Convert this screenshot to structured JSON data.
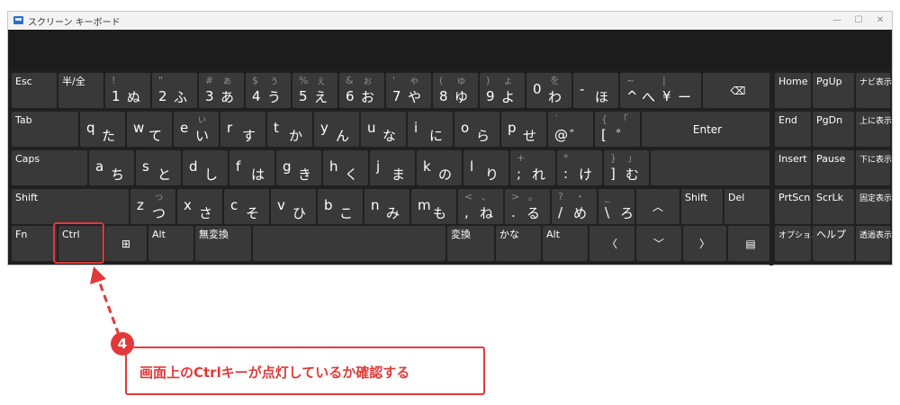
{
  "window": {
    "title": "スクリーン キーボード",
    "minimize_glyph": "—",
    "maximize_glyph": "☐",
    "close_glyph": "✕"
  },
  "keys": {
    "esc": "Esc",
    "hankaku": "半/全",
    "k1": {
      "main": "1",
      "kana": "ぬ",
      "shift": "!"
    },
    "k2": {
      "main": "2",
      "kana": "ふ",
      "shift": "\""
    },
    "k3": {
      "main": "3",
      "kana": "あ",
      "shift": "#",
      "skana": "ぁ"
    },
    "k4": {
      "main": "4",
      "kana": "う",
      "shift": "$",
      "skana": "ぅ"
    },
    "k5": {
      "main": "5",
      "kana": "え",
      "shift": "%",
      "skana": "ぇ"
    },
    "k6": {
      "main": "6",
      "kana": "お",
      "shift": "&",
      "skana": "ぉ"
    },
    "k7": {
      "main": "7",
      "kana": "や",
      "shift": "'",
      "skana": "ゃ"
    },
    "k8": {
      "main": "8",
      "kana": "ゆ",
      "shift": "(",
      "skana": "ゅ"
    },
    "k9": {
      "main": "9",
      "kana": "よ",
      "shift": ")",
      "skana": "ょ"
    },
    "k0": {
      "main": "0",
      "kana": "わ",
      "skana": "を"
    },
    "minus": {
      "main": "-",
      "kana": "ほ"
    },
    "caret": {
      "main": "^",
      "kana": "へ",
      "shift": "~"
    },
    "yen": {
      "main": "¥",
      "kana": "ー",
      "shift": "|"
    },
    "backspace_glyph": "⌫",
    "tab": "Tab",
    "q": {
      "main": "q",
      "kana": "た"
    },
    "w": {
      "main": "w",
      "kana": "て"
    },
    "e": {
      "main": "e",
      "kana": "い",
      "skana": "ぃ"
    },
    "r": {
      "main": "r",
      "kana": "す"
    },
    "t": {
      "main": "t",
      "kana": "か"
    },
    "y": {
      "main": "y",
      "kana": "ん"
    },
    "u": {
      "main": "u",
      "kana": "な"
    },
    "i": {
      "main": "i",
      "kana": "に"
    },
    "o": {
      "main": "o",
      "kana": "ら"
    },
    "p": {
      "main": "p",
      "kana": "せ"
    },
    "at": {
      "main": "@",
      "kana": "゛",
      "shift": "`"
    },
    "bracket_open": {
      "main": "[",
      "kana": "゜",
      "shift": "{",
      "skana": "「"
    },
    "enter": "Enter",
    "caps": "Caps",
    "a": {
      "main": "a",
      "kana": "ち"
    },
    "s": {
      "main": "s",
      "kana": "と"
    },
    "d": {
      "main": "d",
      "kana": "し"
    },
    "f": {
      "main": "f",
      "kana": "は"
    },
    "g": {
      "main": "g",
      "kana": "き"
    },
    "h": {
      "main": "h",
      "kana": "く"
    },
    "j": {
      "main": "j",
      "kana": "ま"
    },
    "k": {
      "main": "k",
      "kana": "の"
    },
    "l": {
      "main": "l",
      "kana": "り"
    },
    "semicolon": {
      "main": ";",
      "kana": "れ",
      "shift": "+"
    },
    "colon": {
      "main": ":",
      "kana": "け",
      "shift": "*"
    },
    "bracket_close": {
      "main": "]",
      "kana": "む",
      "shift": "}",
      "skana": "」"
    },
    "shift_l": "Shift",
    "z": {
      "main": "z",
      "kana": "つ",
      "skana": "っ"
    },
    "x": {
      "main": "x",
      "kana": "さ"
    },
    "c": {
      "main": "c",
      "kana": "そ"
    },
    "v": {
      "main": "v",
      "kana": "ひ"
    },
    "b": {
      "main": "b",
      "kana": "こ"
    },
    "n": {
      "main": "n",
      "kana": "み"
    },
    "m": {
      "main": "m",
      "kana": "も"
    },
    "comma": {
      "main": ",",
      "kana": "ね",
      "shift": "<",
      "skana": "、"
    },
    "period": {
      "main": ".",
      "kana": "る",
      "shift": ">",
      "skana": "。"
    },
    "slash": {
      "main": "/",
      "kana": "め",
      "shift": "?",
      "skana": "・"
    },
    "backslash": {
      "main": "\\",
      "kana": "ろ",
      "shift": "_"
    },
    "up_glyph": "︿",
    "shift_r": "Shift",
    "del": "Del",
    "fn": "Fn",
    "ctrl": "Ctrl",
    "win_glyph": "⊞",
    "alt_l": "Alt",
    "muhenkan": "無変換",
    "henkan": "変換",
    "kana": "かな",
    "alt_r": "Alt",
    "left_glyph": "〈",
    "down_glyph": "﹀",
    "right_glyph": "〉",
    "menu_glyph": "▤",
    "home": "Home",
    "pgup": "PgUp",
    "navi": "ナビ表示",
    "end": "End",
    "pgdn": "PgDn",
    "up_disp": "上に表示",
    "insert": "Insert",
    "pause": "Pause",
    "down_disp": "下に表示",
    "prtscn": "PrtScn",
    "scrlk": "ScrLk",
    "fixed_disp": "固定表示",
    "options": "オプション",
    "help": "ヘルプ",
    "fade": "透過表示"
  },
  "annotation": {
    "step_number": "4",
    "callout": "画面上のCtrlキーが点灯しているか確認する",
    "accent": "#e03a3a"
  }
}
